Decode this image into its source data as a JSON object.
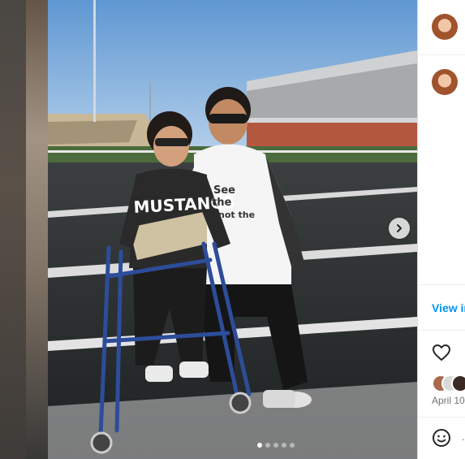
{
  "photo": {
    "shirt_text": "MUSTANGS",
    "tee_text_line1": "See",
    "tee_text_line2": "the",
    "tee_text_line3": "not the",
    "carousel_slides": 5,
    "carousel_active": 1
  },
  "side_panel": {
    "view_insights_label": "View ir",
    "date_label": "April 10",
    "comment_placeholder": "."
  },
  "colors": {
    "link": "#0095f6",
    "muted": "#737373",
    "divider": "#efefef"
  },
  "icons": [
    "chevron-right-icon",
    "heart-icon",
    "emoji-icon"
  ]
}
